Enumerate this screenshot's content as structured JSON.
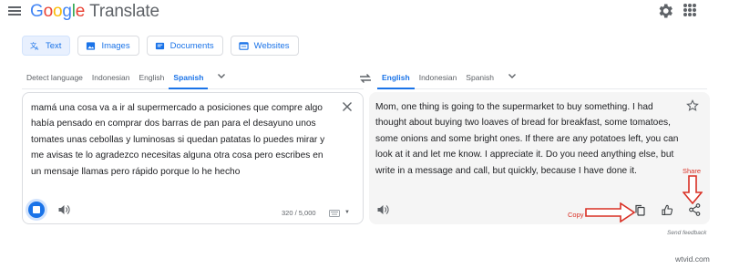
{
  "app": {
    "logo_letters": [
      "G",
      "o",
      "o",
      "g",
      "l",
      "e"
    ],
    "product_name": "Translate"
  },
  "modes": [
    {
      "label": "Text",
      "icon": "translate-icon",
      "active": true
    },
    {
      "label": "Images",
      "icon": "image-icon",
      "active": false
    },
    {
      "label": "Documents",
      "icon": "document-icon",
      "active": false
    },
    {
      "label": "Websites",
      "icon": "website-icon",
      "active": false
    }
  ],
  "source_languages": [
    "Detect language",
    "Indonesian",
    "English",
    "Spanish"
  ],
  "source_active_language": "Spanish",
  "target_languages": [
    "English",
    "Indonesian",
    "Spanish"
  ],
  "target_active_language": "English",
  "source_text": "mamá una cosa va a ir al supermercado a posiciones que compre algo había pensado en comprar dos barras de pan para el desayuno unos tomates unas cebollas y luminosas si quedan patatas lo puedes mirar y me avisas te lo agradezco necesitas alguna otra cosa pero escribes en un mensaje llamas pero rápido porque lo he hecho",
  "translated_text": "Mom, one thing is going to the supermarket to buy something. I had thought about buying two loaves of bread for breakfast, some tomatoes, some onions and some bright ones. If there are any potatoes left, you can look at it and let me know. I appreciate it. Do you need anything else, but write in a message and call, but quickly, because I have done it.",
  "char_count": "320 / 5,000",
  "annotations": {
    "copy_label": "Copy",
    "share_label": "Share",
    "color": "#d93025"
  },
  "send_feedback": "Send feedback",
  "watermark": "wtvid.com",
  "colors": {
    "accent": "#1a73e8",
    "active_bg": "#e8f0fe",
    "output_bg": "#f5f5f5"
  }
}
